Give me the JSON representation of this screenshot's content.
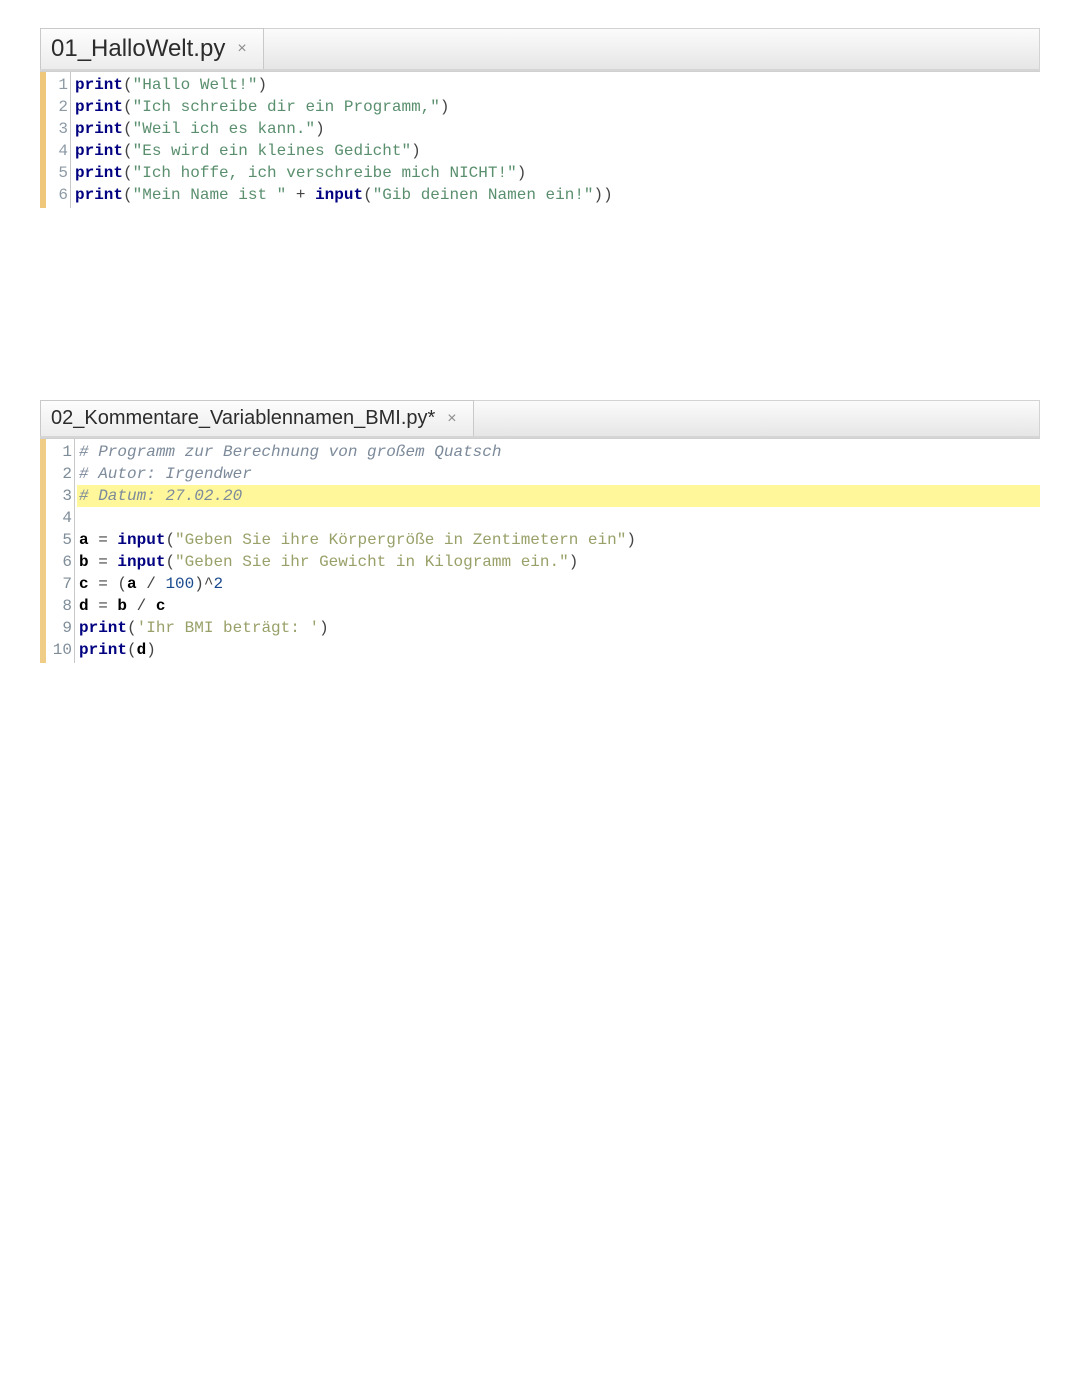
{
  "pane1": {
    "tab_title": "01_HalloWelt.py",
    "close": "×",
    "lines": [
      {
        "n": "1",
        "segs": [
          {
            "cls": "kw",
            "t": "print"
          },
          {
            "cls": "op",
            "t": "("
          },
          {
            "cls": "str",
            "t": "\"Hallo Welt!\""
          },
          {
            "cls": "op",
            "t": ")"
          }
        ]
      },
      {
        "n": "2",
        "segs": [
          {
            "cls": "kw",
            "t": "print"
          },
          {
            "cls": "op",
            "t": "("
          },
          {
            "cls": "str",
            "t": "\"Ich schreibe dir ein Programm,\""
          },
          {
            "cls": "op",
            "t": ")"
          }
        ]
      },
      {
        "n": "3",
        "segs": [
          {
            "cls": "kw",
            "t": "print"
          },
          {
            "cls": "op",
            "t": "("
          },
          {
            "cls": "str",
            "t": "\"Weil ich es kann.\""
          },
          {
            "cls": "op",
            "t": ")"
          }
        ]
      },
      {
        "n": "4",
        "segs": [
          {
            "cls": "kw",
            "t": "print"
          },
          {
            "cls": "op",
            "t": "("
          },
          {
            "cls": "str",
            "t": "\"Es wird ein kleines Gedicht\""
          },
          {
            "cls": "op",
            "t": ")"
          }
        ]
      },
      {
        "n": "5",
        "segs": [
          {
            "cls": "kw",
            "t": "print"
          },
          {
            "cls": "op",
            "t": "("
          },
          {
            "cls": "str",
            "t": "\"Ich hoffe, ich verschreibe mich NICHT!\""
          },
          {
            "cls": "op",
            "t": ")"
          }
        ]
      },
      {
        "n": "6",
        "segs": [
          {
            "cls": "kw",
            "t": "print"
          },
          {
            "cls": "op",
            "t": "("
          },
          {
            "cls": "str",
            "t": "\"Mein Name ist \""
          },
          {
            "cls": "op",
            "t": " + "
          },
          {
            "cls": "kw",
            "t": "input"
          },
          {
            "cls": "op",
            "t": "("
          },
          {
            "cls": "str",
            "t": "\"Gib deinen Namen ein!\""
          },
          {
            "cls": "op",
            "t": ")"
          },
          {
            "cls": "op",
            "t": ")"
          }
        ]
      }
    ]
  },
  "pane2": {
    "tab_title": "02_Kommentare_Variablennamen_BMI.py*",
    "close": "×",
    "lines": [
      {
        "n": "1",
        "hl": false,
        "segs": [
          {
            "cls": "cmt",
            "t": "# Programm zur Berechnung von großem Quatsch"
          }
        ]
      },
      {
        "n": "2",
        "hl": false,
        "segs": [
          {
            "cls": "cmt",
            "t": "# Autor: Irgendwer"
          }
        ]
      },
      {
        "n": "3",
        "hl": true,
        "segs": [
          {
            "cls": "cmt",
            "t": "# Datum: 27.02.20"
          }
        ]
      },
      {
        "n": "4",
        "hl": false,
        "segs": [
          {
            "cls": "",
            "t": ""
          }
        ]
      },
      {
        "n": "5",
        "hl": false,
        "segs": [
          {
            "cls": "var",
            "t": "a"
          },
          {
            "cls": "op",
            "t": " = "
          },
          {
            "cls": "kw",
            "t": "input"
          },
          {
            "cls": "op",
            "t": "("
          },
          {
            "cls": "str2",
            "t": "\"Geben Sie ihre Körpergröße in Zentimetern ein\""
          },
          {
            "cls": "op",
            "t": ")"
          }
        ]
      },
      {
        "n": "6",
        "hl": false,
        "segs": [
          {
            "cls": "var",
            "t": "b"
          },
          {
            "cls": "op",
            "t": " = "
          },
          {
            "cls": "kw",
            "t": "input"
          },
          {
            "cls": "op",
            "t": "("
          },
          {
            "cls": "str2",
            "t": "\"Geben Sie ihr Gewicht in Kilogramm ein.\""
          },
          {
            "cls": "op",
            "t": ")"
          }
        ]
      },
      {
        "n": "7",
        "hl": false,
        "segs": [
          {
            "cls": "var",
            "t": "c"
          },
          {
            "cls": "op",
            "t": " = ("
          },
          {
            "cls": "var",
            "t": "a"
          },
          {
            "cls": "op",
            "t": " / "
          },
          {
            "cls": "num",
            "t": "100"
          },
          {
            "cls": "op",
            "t": ")^"
          },
          {
            "cls": "num",
            "t": "2"
          }
        ]
      },
      {
        "n": "8",
        "hl": false,
        "segs": [
          {
            "cls": "var",
            "t": "d"
          },
          {
            "cls": "op",
            "t": " = "
          },
          {
            "cls": "var",
            "t": "b"
          },
          {
            "cls": "op",
            "t": " / "
          },
          {
            "cls": "var",
            "t": "c"
          }
        ]
      },
      {
        "n": "9",
        "hl": false,
        "segs": [
          {
            "cls": "kw",
            "t": "print"
          },
          {
            "cls": "op",
            "t": "("
          },
          {
            "cls": "str2",
            "t": "'Ihr BMI beträgt: '"
          },
          {
            "cls": "op",
            "t": ")"
          }
        ]
      },
      {
        "n": "10",
        "hl": false,
        "segs": [
          {
            "cls": "kw",
            "t": "print"
          },
          {
            "cls": "op",
            "t": "("
          },
          {
            "cls": "var",
            "t": "d"
          },
          {
            "cls": "op",
            "t": ")"
          }
        ]
      }
    ]
  }
}
